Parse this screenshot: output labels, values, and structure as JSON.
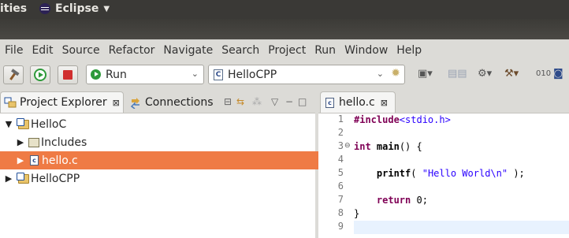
{
  "top_panel": {
    "left_text": "ities",
    "app_name": "Eclipse"
  },
  "menubar": {
    "items": [
      "File",
      "Edit",
      "Source",
      "Refactor",
      "Navigate",
      "Search",
      "Project",
      "Run",
      "Window",
      "Help"
    ]
  },
  "toolbar": {
    "build_icon": "hammer-icon",
    "run_icon": "run-icon",
    "stop_icon": "stop-icon",
    "run_config": "Run",
    "launch_target": "HelloCPP"
  },
  "left_panel": {
    "active_tab": "Project Explorer",
    "inactive_tab": "Connections",
    "close_glyph": "⊠",
    "tree": [
      {
        "label": "HelloC",
        "expanded": true,
        "icon": "project-folder-icon",
        "level": 0
      },
      {
        "label": "Includes",
        "expanded": false,
        "icon": "includes-icon",
        "level": 1
      },
      {
        "label": "hello.c",
        "expanded": false,
        "icon": "c-file-icon",
        "level": 1,
        "selected": true
      },
      {
        "label": "HelloCPP",
        "expanded": false,
        "icon": "project-folder-icon",
        "level": 0
      }
    ]
  },
  "editor": {
    "tab_label": "hello.c",
    "close_glyph": "⊠",
    "line_numbers": [
      "1",
      "2",
      "3",
      "4",
      "5",
      "6",
      "7",
      "8",
      "9"
    ],
    "lines": {
      "l1_kw": "#include",
      "l1_path": "<stdio.h>",
      "l3_kw": "int",
      "l3_fn": "main",
      "l3_rest": "() {",
      "l5_fn": "printf",
      "l5_open": "( ",
      "l5_str": "\"Hello World\\n\"",
      "l5_close": " );",
      "l7_kw": "return",
      "l7_rest": " 0;",
      "l8": "}"
    }
  },
  "colors": {
    "selection": "#ef7b45",
    "keyword": "#7f0055",
    "string": "#2a00ff",
    "current_line": "#e8f2fe"
  }
}
